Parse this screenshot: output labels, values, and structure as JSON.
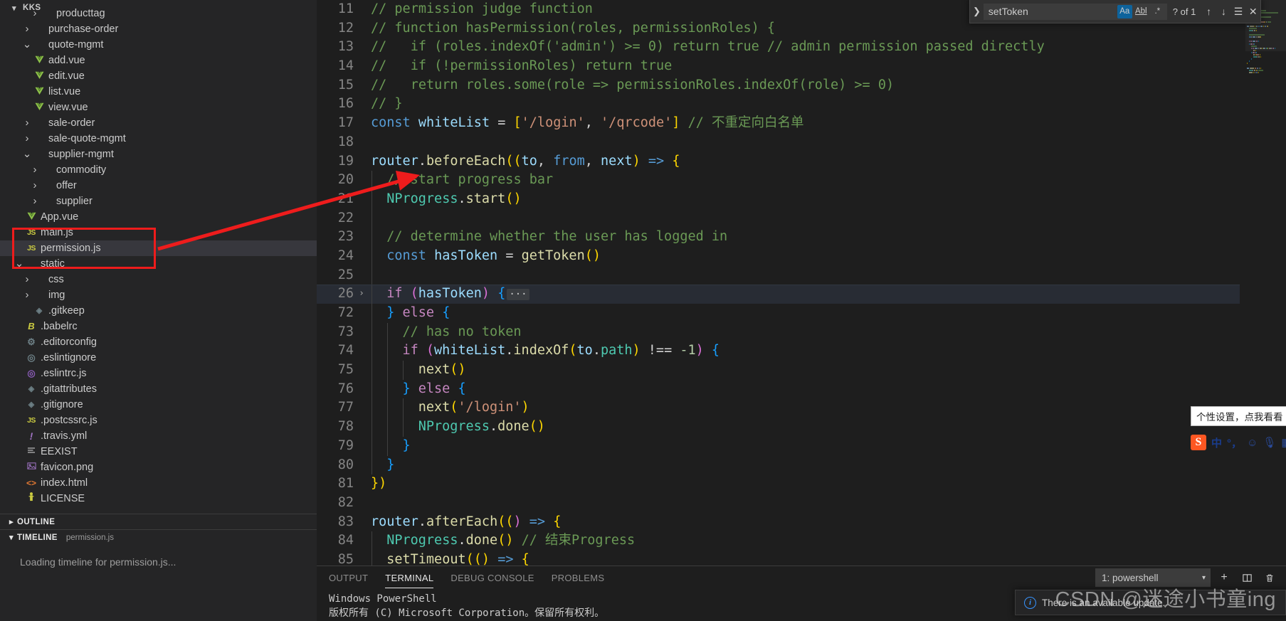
{
  "window": {
    "theme_bg": "#1e1e1e",
    "sidebar_bg": "#252526",
    "accent": "#0e639c",
    "annotation_color": "#ee1c1c"
  },
  "sidebar": {
    "explorer_title": "KKS",
    "tree": [
      {
        "label": "producttag",
        "indent": 3,
        "twisty": ">",
        "icon": "folder-icon",
        "icon_class": "",
        "selected": false
      },
      {
        "label": "purchase-order",
        "indent": 2,
        "twisty": ">",
        "icon": "folder-icon",
        "icon_class": "",
        "selected": false
      },
      {
        "label": "quote-mgmt",
        "indent": 2,
        "twisty": "v",
        "icon": "folder-open-icon",
        "icon_class": "",
        "selected": false
      },
      {
        "label": "add.vue",
        "indent": 2,
        "twisty": "",
        "icon": "vue-file-icon",
        "icon_class": "ico-vue",
        "glyph": "V",
        "selected": false
      },
      {
        "label": "edit.vue",
        "indent": 2,
        "twisty": "",
        "icon": "vue-file-icon",
        "icon_class": "ico-vue",
        "glyph": "V",
        "selected": false
      },
      {
        "label": "list.vue",
        "indent": 2,
        "twisty": "",
        "icon": "vue-file-icon",
        "icon_class": "ico-vue",
        "glyph": "V",
        "selected": false
      },
      {
        "label": "view.vue",
        "indent": 2,
        "twisty": "",
        "icon": "vue-file-icon",
        "icon_class": "ico-vue",
        "glyph": "V",
        "selected": false
      },
      {
        "label": "sale-order",
        "indent": 2,
        "twisty": ">",
        "icon": "folder-icon",
        "icon_class": "",
        "selected": false
      },
      {
        "label": "sale-quote-mgmt",
        "indent": 2,
        "twisty": ">",
        "icon": "folder-icon",
        "icon_class": "",
        "selected": false
      },
      {
        "label": "supplier-mgmt",
        "indent": 2,
        "twisty": "v",
        "icon": "folder-open-icon",
        "icon_class": "",
        "selected": false
      },
      {
        "label": "commodity",
        "indent": 3,
        "twisty": ">",
        "icon": "folder-icon",
        "icon_class": "",
        "selected": false
      },
      {
        "label": "offer",
        "indent": 3,
        "twisty": ">",
        "icon": "folder-icon",
        "icon_class": "",
        "selected": false
      },
      {
        "label": "supplier",
        "indent": 3,
        "twisty": ">",
        "icon": "folder-icon",
        "icon_class": "",
        "selected": false
      },
      {
        "label": "App.vue",
        "indent": 1,
        "twisty": "",
        "icon": "vue-file-icon",
        "icon_class": "ico-vue",
        "glyph": "V",
        "selected": false
      },
      {
        "label": "main.js",
        "indent": 1,
        "twisty": "",
        "icon": "js-file-icon",
        "icon_class": "ico-js",
        "glyph": "JS",
        "selected": false
      },
      {
        "label": "permission.js",
        "indent": 1,
        "twisty": "",
        "icon": "js-file-icon",
        "icon_class": "ico-js",
        "glyph": "JS",
        "selected": true
      },
      {
        "label": "static",
        "indent": 1,
        "twisty": "v",
        "icon": "folder-open-icon",
        "icon_class": "",
        "selected": false
      },
      {
        "label": "css",
        "indent": 2,
        "twisty": ">",
        "icon": "folder-icon",
        "icon_class": "",
        "selected": false
      },
      {
        "label": "img",
        "indent": 2,
        "twisty": ">",
        "icon": "folder-icon",
        "icon_class": "",
        "selected": false
      },
      {
        "label": ".gitkeep",
        "indent": 2,
        "twisty": "",
        "icon": "git-file-icon",
        "icon_class": "ico-git",
        "glyph": "◈",
        "selected": false
      },
      {
        "label": ".babelrc",
        "indent": 1,
        "twisty": "",
        "icon": "babel-icon",
        "icon_class": "ico-babel",
        "glyph": "B",
        "selected": false
      },
      {
        "label": ".editorconfig",
        "indent": 1,
        "twisty": "",
        "icon": "gear-icon",
        "icon_class": "ico-gear",
        "glyph": "⚙",
        "selected": false
      },
      {
        "label": ".eslintignore",
        "indent": 1,
        "twisty": "",
        "icon": "eslint-icon",
        "icon_class": "ico-eslint-dim",
        "glyph": "◎",
        "selected": false
      },
      {
        "label": ".eslintrc.js",
        "indent": 1,
        "twisty": "",
        "icon": "eslint-icon",
        "icon_class": "ico-eslint",
        "glyph": "◎",
        "selected": false
      },
      {
        "label": ".gitattributes",
        "indent": 1,
        "twisty": "",
        "icon": "git-file-icon",
        "icon_class": "ico-git",
        "glyph": "◈",
        "selected": false
      },
      {
        "label": ".gitignore",
        "indent": 1,
        "twisty": "",
        "icon": "git-file-icon",
        "icon_class": "ico-git",
        "glyph": "◈",
        "selected": false
      },
      {
        "label": ".postcssrc.js",
        "indent": 1,
        "twisty": "",
        "icon": "js-file-icon",
        "icon_class": "ico-js",
        "glyph": "JS",
        "selected": false
      },
      {
        "label": ".travis.yml",
        "indent": 1,
        "twisty": "",
        "icon": "travis-icon",
        "icon_class": "ico-excl",
        "glyph": "!",
        "selected": false
      },
      {
        "label": "EEXIST",
        "indent": 1,
        "twisty": "",
        "icon": "text-file-icon",
        "icon_class": "ico-lines",
        "glyph": "☰",
        "selected": false
      },
      {
        "label": "favicon.png",
        "indent": 1,
        "twisty": "",
        "icon": "image-file-icon",
        "icon_class": "ico-img",
        "glyph": "Ὓc",
        "selected": false
      },
      {
        "label": "index.html",
        "indent": 1,
        "twisty": "",
        "icon": "html-file-icon",
        "icon_class": "ico-html",
        "glyph": "<>",
        "selected": false
      },
      {
        "label": "LICENSE",
        "indent": 1,
        "twisty": "",
        "icon": "license-icon",
        "icon_class": "ico-lic",
        "glyph": "⚷",
        "selected": false
      }
    ],
    "outline": {
      "title": "OUTLINE",
      "twisty": ">"
    },
    "timeline": {
      "title": "TIMELINE",
      "twisty": "v",
      "subtitle": "permission.js",
      "body": "Loading timeline for permission.js..."
    }
  },
  "find_widget": {
    "query": "setToken",
    "placeholder": "Find",
    "match_case_label": "Aa",
    "whole_word_label": "Abl",
    "regex_label": ".*",
    "match_count": "? of 1",
    "prev_icon": "arrow-up-icon",
    "next_icon": "arrow-down-icon",
    "selection_icon": "find-in-selection-icon",
    "close_icon": "close-icon",
    "expand_icon": "chevron-right-icon"
  },
  "editor": {
    "file": "permission.js",
    "first_visible_line": 11,
    "folded_line": 26,
    "lines": [
      {
        "n": 11,
        "indent": 0,
        "segs": [
          [
            "c",
            "// permission judge function"
          ]
        ]
      },
      {
        "n": 12,
        "indent": 0,
        "segs": [
          [
            "c",
            "// function hasPermission(roles, permissionRoles) {"
          ]
        ]
      },
      {
        "n": 13,
        "indent": 0,
        "segs": [
          [
            "c",
            "//   if (roles.indexOf('admin') >= 0) return true // admin permission passed directly"
          ]
        ]
      },
      {
        "n": 14,
        "indent": 0,
        "segs": [
          [
            "c",
            "//   if (!permissionRoles) return true"
          ]
        ]
      },
      {
        "n": 15,
        "indent": 0,
        "segs": [
          [
            "c",
            "//   return roles.some(role => permissionRoles.indexOf(role) >= 0)"
          ]
        ]
      },
      {
        "n": 16,
        "indent": 0,
        "segs": [
          [
            "c",
            "// }"
          ]
        ]
      },
      {
        "n": 17,
        "indent": 0,
        "segs": [
          [
            "kw2",
            "const"
          ],
          [
            "op",
            " "
          ],
          [
            "id",
            "whiteList"
          ],
          [
            "op",
            " = "
          ],
          [
            "br",
            "["
          ],
          [
            "st",
            "'/login'"
          ],
          [
            "op",
            ", "
          ],
          [
            "st",
            "'/qrcode'"
          ],
          [
            "br",
            "]"
          ],
          [
            "op",
            " "
          ],
          [
            "c",
            "// 不重定向白名单"
          ]
        ]
      },
      {
        "n": 18,
        "indent": 0,
        "segs": []
      },
      {
        "n": 19,
        "indent": 0,
        "segs": [
          [
            "id",
            "router"
          ],
          [
            "op",
            "."
          ],
          [
            "fn",
            "beforeEach"
          ],
          [
            "br",
            "(("
          ],
          [
            "id",
            "to"
          ],
          [
            "op",
            ", "
          ],
          [
            "kw2",
            "from"
          ],
          [
            "op",
            ", "
          ],
          [
            "id",
            "next"
          ],
          [
            "br",
            ")"
          ],
          [
            "op",
            " "
          ],
          [
            "kw2",
            "=>"
          ],
          [
            "op",
            " "
          ],
          [
            "br",
            "{"
          ]
        ]
      },
      {
        "n": 20,
        "indent": 1,
        "segs": [
          [
            "c",
            "// start progress bar"
          ]
        ]
      },
      {
        "n": 21,
        "indent": 1,
        "segs": [
          [
            "pr",
            "NProgress"
          ],
          [
            "op",
            "."
          ],
          [
            "fn",
            "start"
          ],
          [
            "br",
            "()"
          ]
        ]
      },
      {
        "n": 22,
        "indent": 1,
        "segs": []
      },
      {
        "n": 23,
        "indent": 1,
        "segs": [
          [
            "c",
            "// determine whether the user has logged in"
          ]
        ]
      },
      {
        "n": 24,
        "indent": 1,
        "segs": [
          [
            "kw2",
            "const"
          ],
          [
            "op",
            " "
          ],
          [
            "id",
            "hasToken"
          ],
          [
            "op",
            " = "
          ],
          [
            "fn",
            "getToken"
          ],
          [
            "br",
            "()"
          ]
        ]
      },
      {
        "n": 25,
        "indent": 1,
        "segs": []
      },
      {
        "n": 26,
        "indent": 1,
        "fold": true,
        "highlight": true,
        "segs": [
          [
            "kw",
            "if"
          ],
          [
            "op",
            " "
          ],
          [
            "br2",
            "("
          ],
          [
            "id",
            "hasToken"
          ],
          [
            "br2",
            ")"
          ],
          [
            "op",
            " "
          ],
          [
            "br3",
            "{"
          ]
        ],
        "folded_marker": "···"
      },
      {
        "n": 72,
        "indent": 1,
        "segs": [
          [
            "br3",
            "}"
          ],
          [
            "op",
            " "
          ],
          [
            "kw",
            "else"
          ],
          [
            "op",
            " "
          ],
          [
            "br3",
            "{"
          ]
        ]
      },
      {
        "n": 73,
        "indent": 2,
        "segs": [
          [
            "c",
            "// has no token"
          ]
        ]
      },
      {
        "n": 74,
        "indent": 2,
        "segs": [
          [
            "kw",
            "if"
          ],
          [
            "op",
            " "
          ],
          [
            "br2",
            "("
          ],
          [
            "id",
            "whiteList"
          ],
          [
            "op",
            "."
          ],
          [
            "fn",
            "indexOf"
          ],
          [
            "br",
            "("
          ],
          [
            "id",
            "to"
          ],
          [
            "op",
            "."
          ],
          [
            "pr",
            "path"
          ],
          [
            "br",
            ")"
          ],
          [
            "op",
            " !== "
          ],
          [
            "nu",
            "-1"
          ],
          [
            "br2",
            ")"
          ],
          [
            "op",
            " "
          ],
          [
            "br3",
            "{"
          ]
        ]
      },
      {
        "n": 75,
        "indent": 3,
        "segs": [
          [
            "fn",
            "next"
          ],
          [
            "br",
            "()"
          ]
        ]
      },
      {
        "n": 76,
        "indent": 2,
        "segs": [
          [
            "br3",
            "}"
          ],
          [
            "op",
            " "
          ],
          [
            "kw",
            "else"
          ],
          [
            "op",
            " "
          ],
          [
            "br3",
            "{"
          ]
        ]
      },
      {
        "n": 77,
        "indent": 3,
        "segs": [
          [
            "fn",
            "next"
          ],
          [
            "br",
            "("
          ],
          [
            "st",
            "'/login'"
          ],
          [
            "br",
            ")"
          ]
        ]
      },
      {
        "n": 78,
        "indent": 3,
        "segs": [
          [
            "pr",
            "NProgress"
          ],
          [
            "op",
            "."
          ],
          [
            "fn",
            "done"
          ],
          [
            "br",
            "()"
          ]
        ]
      },
      {
        "n": 79,
        "indent": 2,
        "segs": [
          [
            "br3",
            "}"
          ]
        ]
      },
      {
        "n": 80,
        "indent": 1,
        "segs": [
          [
            "br3",
            "}"
          ]
        ]
      },
      {
        "n": 81,
        "indent": 0,
        "segs": [
          [
            "br",
            "})"
          ]
        ]
      },
      {
        "n": 82,
        "indent": 0,
        "segs": []
      },
      {
        "n": 83,
        "indent": 0,
        "segs": [
          [
            "id",
            "router"
          ],
          [
            "op",
            "."
          ],
          [
            "fn",
            "afterEach"
          ],
          [
            "br",
            "(("
          ],
          [
            "br2",
            ")"
          ],
          [
            "op",
            " "
          ],
          [
            "kw2",
            "=>"
          ],
          [
            "op",
            " "
          ],
          [
            "br",
            "{"
          ]
        ]
      },
      {
        "n": 84,
        "indent": 1,
        "segs": [
          [
            "pr",
            "NProgress"
          ],
          [
            "op",
            "."
          ],
          [
            "fn",
            "done"
          ],
          [
            "br",
            "()"
          ],
          [
            "op",
            " "
          ],
          [
            "c",
            "// 结束Progress"
          ]
        ]
      },
      {
        "n": 85,
        "indent": 1,
        "segs": [
          [
            "fn",
            "setTimeout"
          ],
          [
            "br",
            "(()"
          ],
          [
            "op",
            " "
          ],
          [
            "kw2",
            "=>"
          ],
          [
            "op",
            " "
          ],
          [
            "br",
            "{"
          ]
        ]
      }
    ]
  },
  "panel": {
    "tabs": [
      {
        "label": "OUTPUT",
        "active": false
      },
      {
        "label": "TERMINAL",
        "active": true
      },
      {
        "label": "DEBUG CONSOLE",
        "active": false
      },
      {
        "label": "PROBLEMS",
        "active": false
      }
    ],
    "terminal_select": "1: powershell",
    "new_terminal_icon": "plus-icon",
    "split_terminal_icon": "split-panel-icon",
    "kill_terminal_icon": "trash-icon",
    "chevron_icon": "chevron-down-icon",
    "output_lines": [
      "Windows PowerShell",
      "版权所有 (C) Microsoft Corporation。保留所有权利。"
    ]
  },
  "notification": {
    "icon": "info-icon",
    "message": "There is an available update."
  },
  "watermark": "CSDN @迷途小书童ing",
  "ime": {
    "tooltip": "个性设置，点我看看",
    "logo": "S",
    "items": [
      "中",
      "°，"
    ],
    "icons": [
      "smiley-icon",
      "microphone-icon",
      "keyboard-icon"
    ]
  }
}
